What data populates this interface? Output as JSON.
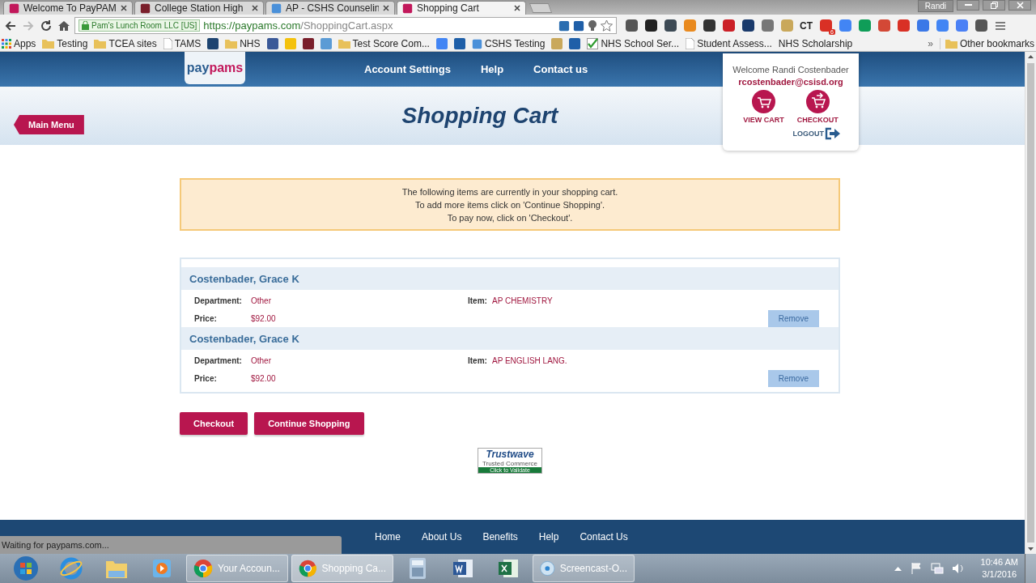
{
  "browser": {
    "tabs": [
      {
        "title": "Welcome To PayPAM",
        "kind": "paypams",
        "selected": false
      },
      {
        "title": "College Station High",
        "kind": "cs",
        "selected": false
      },
      {
        "title": "AP - CSHS Counselin",
        "kind": "w",
        "selected": false
      },
      {
        "title": "Shopping Cart",
        "kind": "paypams",
        "selected": true
      }
    ],
    "profile": "Randi",
    "security_label": "Pam's Lunch Room LLC [US]",
    "url_domain": "https://paypams.com",
    "url_path": "/ShoppingCart.aspx",
    "extensions": [
      {
        "color": "#555555"
      },
      {
        "color": "#222222"
      },
      {
        "color": "#3d4a55"
      },
      {
        "color": "#e98a1f"
      },
      {
        "color": "#333333"
      },
      {
        "color": "#cb2027"
      },
      {
        "color": "#1a3a6b"
      },
      {
        "color": "#777777"
      },
      {
        "color": "#c9a85b"
      },
      {
        "text": "CT"
      },
      {
        "color": "#d93025",
        "badge": "6"
      },
      {
        "color": "#4285f4"
      },
      {
        "color": "#0f9d58"
      },
      {
        "color": "#d34836"
      },
      {
        "color": "#d93025"
      },
      {
        "color": "#3b78e7"
      },
      {
        "color": "#4285f4"
      },
      {
        "color": "#4a80f5"
      },
      {
        "color": "#555555"
      }
    ],
    "bookmarks": [
      {
        "kind": "apps",
        "label": "Apps"
      },
      {
        "kind": "folder",
        "label": "Testing"
      },
      {
        "kind": "folder",
        "label": "TCEA sites"
      },
      {
        "kind": "page",
        "label": "TAMS"
      },
      {
        "kind": "icon",
        "color": "#1e4470"
      },
      {
        "kind": "folder",
        "label": "NHS"
      },
      {
        "kind": "icon",
        "color": "#3b5998"
      },
      {
        "kind": "icon",
        "color": "#f4c20d"
      },
      {
        "kind": "icon",
        "color": "#7a1f2b"
      },
      {
        "kind": "icon",
        "color": "#5b9bd5"
      },
      {
        "kind": "folder",
        "label": "Test Score Com..."
      },
      {
        "kind": "icon",
        "color": "#4285f4"
      },
      {
        "kind": "icon",
        "color": "#1f5fa8"
      },
      {
        "kind": "site",
        "label": "CSHS Testing"
      },
      {
        "kind": "icon",
        "color": "#c9a85b"
      },
      {
        "kind": "icon",
        "color": "#1f5fa8"
      },
      {
        "kind": "check",
        "label": "NHS School Ser..."
      },
      {
        "kind": "page",
        "label": "Student Assess..."
      },
      {
        "kind": "plain",
        "label": "NHS Scholarship"
      }
    ],
    "more_bookmarks": "»",
    "other_bookmarks": "Other bookmarks",
    "status": "Waiting for paypams.com..."
  },
  "site": {
    "logo_first": "pay",
    "logo_second": "pams",
    "nav": [
      "Account Settings",
      "Help",
      "Contact us"
    ],
    "main_menu": "Main Menu",
    "title": "Shopping Cart",
    "user": {
      "welcome": "Welcome Randi Costenbader",
      "email": "rcostenbader@csisd.org",
      "actions": [
        {
          "label": "VIEW CART",
          "kind": "cart"
        },
        {
          "label": "CHECKOUT",
          "kind": "checkout"
        }
      ],
      "logout": "LOGOUT"
    },
    "notice": [
      "The following items are currently in your shopping cart.",
      "To add more items click on 'Continue Shopping'.",
      "To pay now, click on 'Checkout'."
    ],
    "cart_items": [
      {
        "student": "Costenbader, Grace K",
        "department_label": "Department:",
        "department": "Other",
        "item_label": "Item:",
        "item": "AP CHEMISTRY",
        "price_label": "Price:",
        "price": "$92.00",
        "remove": "Remove"
      },
      {
        "student": "Costenbader, Grace K",
        "department_label": "Department:",
        "department": "Other",
        "item_label": "Item:",
        "item": "AP ENGLISH LANG.",
        "price_label": "Price:",
        "price": "$92.00",
        "remove": "Remove"
      }
    ],
    "buttons": [
      "Checkout",
      "Continue Shopping"
    ],
    "trust_badge": {
      "name": "Trustwave",
      "line1": "Trusted Commerce",
      "line2": "Click to Validate"
    },
    "footer": [
      "Home",
      "About Us",
      "Benefits",
      "Help",
      "Contact Us"
    ]
  },
  "taskbar": {
    "items": [
      {
        "kind": "start",
        "selected": false
      },
      {
        "kind": "ie",
        "selected": false
      },
      {
        "kind": "explorer",
        "selected": false
      },
      {
        "kind": "media",
        "selected": false
      },
      {
        "kind": "chrome",
        "label": "Your Accoun...",
        "selected": false
      },
      {
        "kind": "chrome",
        "label": "Shopping Ca...",
        "selected": true
      },
      {
        "kind": "calculator",
        "selected": false
      },
      {
        "kind": "word",
        "selected": false
      },
      {
        "kind": "excel",
        "selected": false
      },
      {
        "kind": "screencast",
        "label": "Screencast-O...",
        "selected": false
      }
    ],
    "time": "10:46 AM",
    "date": "3/1/2016"
  }
}
